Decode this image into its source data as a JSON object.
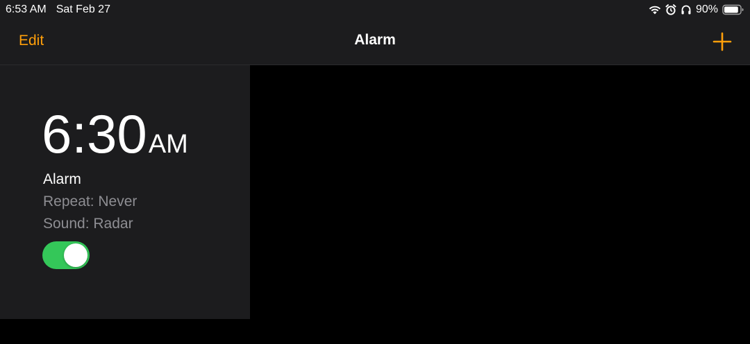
{
  "status_bar": {
    "time": "6:53 AM",
    "date": "Sat Feb 27",
    "battery_percent": "90%",
    "icons": [
      "wifi-icon",
      "alarm-clock-icon",
      "headphones-icon",
      "battery-icon"
    ],
    "battery_level": 0.9
  },
  "nav": {
    "edit_label": "Edit",
    "title": "Alarm",
    "add_icon": "plus-icon"
  },
  "alarm": {
    "time": "6:30",
    "period": "AM",
    "label": "Alarm",
    "repeat": "Repeat: Never",
    "sound": "Sound: Radar",
    "enabled": true
  },
  "colors": {
    "accent": "#ff9f0a",
    "toggle_on": "#34c759",
    "secondary_text": "#8e8e93",
    "panel_bg": "#1c1c1e"
  }
}
